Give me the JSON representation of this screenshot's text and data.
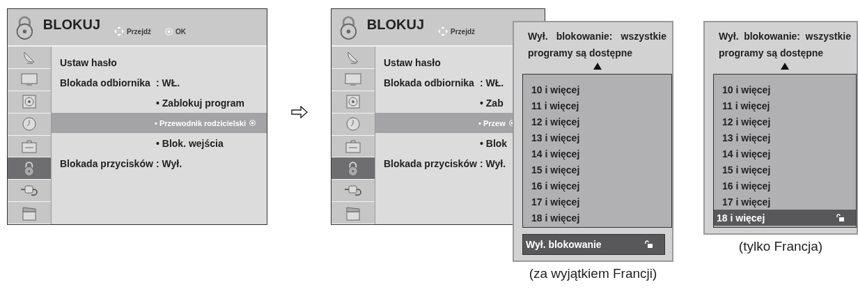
{
  "menus": [
    {
      "title": "BLOKUJ",
      "hints": [
        {
          "kind": "move",
          "label": "Przejdź"
        },
        {
          "kind": "ok",
          "label": "OK"
        }
      ],
      "sidebar": [
        {
          "kind": "satellite",
          "selected": false
        },
        {
          "kind": "monitor",
          "selected": false
        },
        {
          "kind": "speaker",
          "selected": false
        },
        {
          "kind": "clock",
          "selected": false
        },
        {
          "kind": "toolbox",
          "selected": false
        },
        {
          "kind": "lock",
          "selected": true
        },
        {
          "kind": "plug",
          "selected": false
        },
        {
          "kind": "clapper",
          "selected": false
        }
      ],
      "items": [
        {
          "kind": "setting",
          "label": "Ustaw hasło",
          "selected": false
        },
        {
          "kind": "setting",
          "label": "Blokada odbiornika",
          "value": ": WŁ.",
          "selected": false
        },
        {
          "kind": "sub",
          "label": "• Zablokuj program",
          "selected": false
        },
        {
          "kind": "sub",
          "label": "• Przewodnik rodzicielski",
          "selected": true
        },
        {
          "kind": "sub",
          "label": "• Blok. wejścia",
          "selected": false
        },
        {
          "kind": "setting",
          "label": "Blokada przycisków",
          "value": ": Wył.",
          "selected": false
        }
      ]
    },
    {
      "title": "BLOKUJ",
      "hints": [
        {
          "kind": "move",
          "label": "Przejdź"
        }
      ],
      "sidebar": [
        {
          "kind": "satellite",
          "selected": false
        },
        {
          "kind": "monitor",
          "selected": false
        },
        {
          "kind": "speaker",
          "selected": false
        },
        {
          "kind": "clock",
          "selected": false
        },
        {
          "kind": "toolbox",
          "selected": false
        },
        {
          "kind": "lock",
          "selected": true
        },
        {
          "kind": "plug",
          "selected": false
        },
        {
          "kind": "clapper",
          "selected": false
        }
      ],
      "items": [
        {
          "kind": "setting",
          "label": "Ustaw hasło",
          "selected": false
        },
        {
          "kind": "setting",
          "label": "Blokada odbiornika",
          "value": ": WŁ.",
          "selected": false
        },
        {
          "kind": "sub",
          "label": "• Zab",
          "selected": false
        },
        {
          "kind": "sub",
          "label": "• Przew",
          "selected": true
        },
        {
          "kind": "sub",
          "label": "• Blok",
          "selected": false
        },
        {
          "kind": "setting",
          "label": "Blokada przycisków",
          "value": ": Wył.",
          "selected": false
        }
      ]
    }
  ],
  "popups": [
    {
      "message": "Wył. blokowanie: wszystkie programy są dostępne",
      "options": [
        {
          "label": "10 i więcej",
          "selected": false
        },
        {
          "label": "11 i więcej",
          "selected": false
        },
        {
          "label": "12 i więcej",
          "selected": false
        },
        {
          "label": "13 i więcej",
          "selected": false
        },
        {
          "label": "14 i więcej",
          "selected": false
        },
        {
          "label": "15 i więcej",
          "selected": false
        },
        {
          "label": "16 i więcej",
          "selected": false
        },
        {
          "label": "17 i więcej",
          "selected": false
        },
        {
          "label": "18 i więcej",
          "selected": false
        }
      ],
      "footer": {
        "label": "Wył. blokowanie",
        "selected": true
      },
      "caption": "(za wyjątkiem Francji)"
    },
    {
      "message": "Wył. blokowanie: wszystkie programy są dostępne",
      "options": [
        {
          "label": "10 i więcej",
          "selected": false
        },
        {
          "label": "11 i więcej",
          "selected": false
        },
        {
          "label": "12 i więcej",
          "selected": false
        },
        {
          "label": "13 i więcej",
          "selected": false
        },
        {
          "label": "14 i więcej",
          "selected": false
        },
        {
          "label": "15 i więcej",
          "selected": false
        },
        {
          "label": "16 i więcej",
          "selected": false
        },
        {
          "label": "17 i więcej",
          "selected": false
        },
        {
          "label": "18 i więcej",
          "selected": true
        }
      ],
      "caption": "(tylko Francja)"
    }
  ]
}
